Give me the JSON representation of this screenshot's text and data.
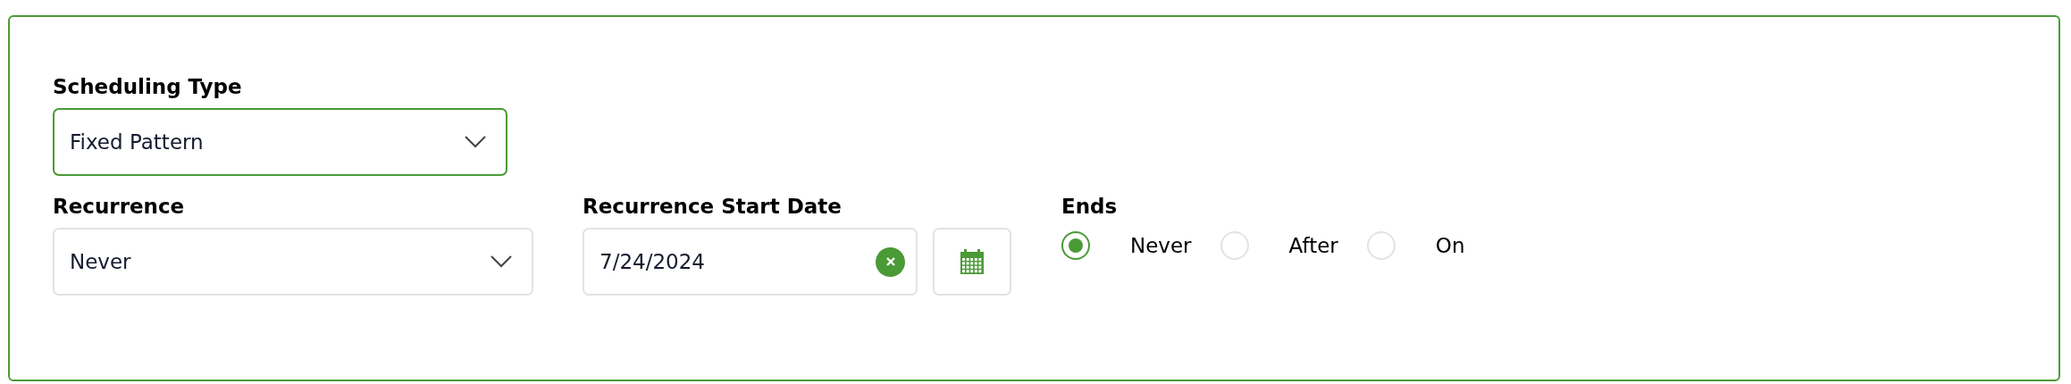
{
  "scheduling_type": {
    "label": "Scheduling Type",
    "value": "Fixed Pattern",
    "focused": true
  },
  "recurrence": {
    "label": "Recurrence",
    "value": "Never"
  },
  "start_date": {
    "label": "Recurrence Start Date",
    "value": "7/24/2024"
  },
  "ends": {
    "label": "Ends",
    "options": [
      {
        "label": "Never",
        "selected": true
      },
      {
        "label": "After",
        "selected": false
      },
      {
        "label": "On",
        "selected": false
      }
    ]
  }
}
